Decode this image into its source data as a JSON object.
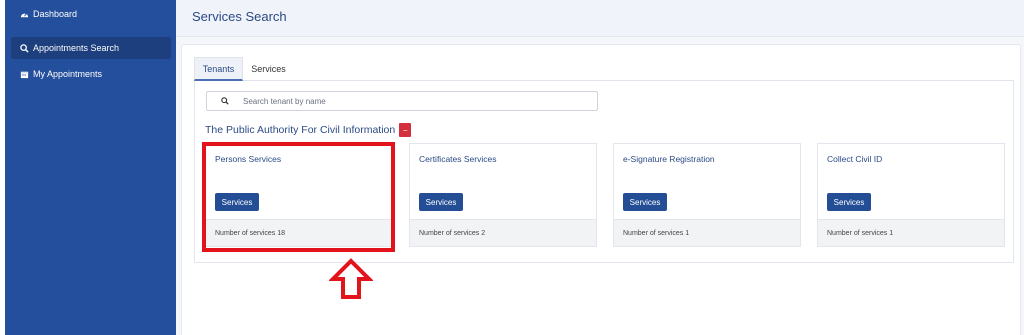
{
  "sidebar": {
    "items": [
      {
        "label": "Dashboard",
        "icon": "dashboard-icon"
      },
      {
        "label": "Appointments Search",
        "icon": "search-icon"
      },
      {
        "label": "My Appointments",
        "icon": "calendar-icon"
      }
    ]
  },
  "header": {
    "title": "Services Search"
  },
  "tabs": [
    {
      "label": "Tenants"
    },
    {
      "label": "Services"
    }
  ],
  "search": {
    "placeholder": "Search tenant by name",
    "value": ""
  },
  "tenant": {
    "name": "The Public Authority For Civil Information",
    "collapse_symbol": "−"
  },
  "cards": [
    {
      "name": "Persons Services",
      "button": "Services",
      "count_text": "Number of services 18"
    },
    {
      "name": "Certificates Services",
      "button": "Services",
      "count_text": "Number of services 2"
    },
    {
      "name": "e-Signature Registration",
      "button": "Services",
      "count_text": "Number of services 1"
    },
    {
      "name": "Collect Civil ID",
      "button": "Services",
      "count_text": "Number of services 1"
    }
  ],
  "colors": {
    "sidebar": "#244f9c",
    "accent": "#234e96",
    "highlight": "#e3131c"
  }
}
